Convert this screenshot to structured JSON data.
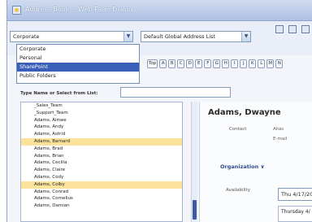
{
  "window": {
    "title": "Address Book -- Web Page Dialog"
  },
  "toolbar": {
    "source_select": {
      "value": "Corporate"
    },
    "address_list_select": {
      "value": "Default Global Address List"
    },
    "alpha_buttons": [
      "Top",
      "A",
      "B",
      "C",
      "D",
      "E",
      "F",
      "G",
      "H",
      "I",
      "J",
      "K",
      "L",
      "M",
      "N"
    ]
  },
  "dropdown": {
    "options": [
      "Corporate",
      "Personal",
      "SharePoint",
      "Public Folders"
    ],
    "selected_index": 2
  },
  "search": {
    "label": "Type Name or Select from List:"
  },
  "contacts": [
    {
      "name": "_Sales_Team"
    },
    {
      "name": "_Support_Team"
    },
    {
      "name": "Adams, Aimee"
    },
    {
      "name": "Adams, Andy"
    },
    {
      "name": "Adams, Astrid"
    },
    {
      "name": "Adams, Barnard",
      "highlighted": true
    },
    {
      "name": "Adams, Brad"
    },
    {
      "name": "Adams, Brian"
    },
    {
      "name": "Adams, Cecilia"
    },
    {
      "name": "Adams, Claire"
    },
    {
      "name": "Adams, Cody"
    },
    {
      "name": "Adams, Colby",
      "highlighted": true
    },
    {
      "name": "Adams, Conrad"
    },
    {
      "name": "Adams, Cornelius"
    },
    {
      "name": "Adams, Damian"
    }
  ],
  "detail": {
    "name": "Adams, Dwayne",
    "contact_label": "Contact",
    "alias_label": "Alias",
    "email_label": "E-mail",
    "organization_label": "Organization ∨",
    "availability_label": "Availability",
    "availability_value": "Thu 4/17/20",
    "availability_slot": "Thursday 4/"
  }
}
